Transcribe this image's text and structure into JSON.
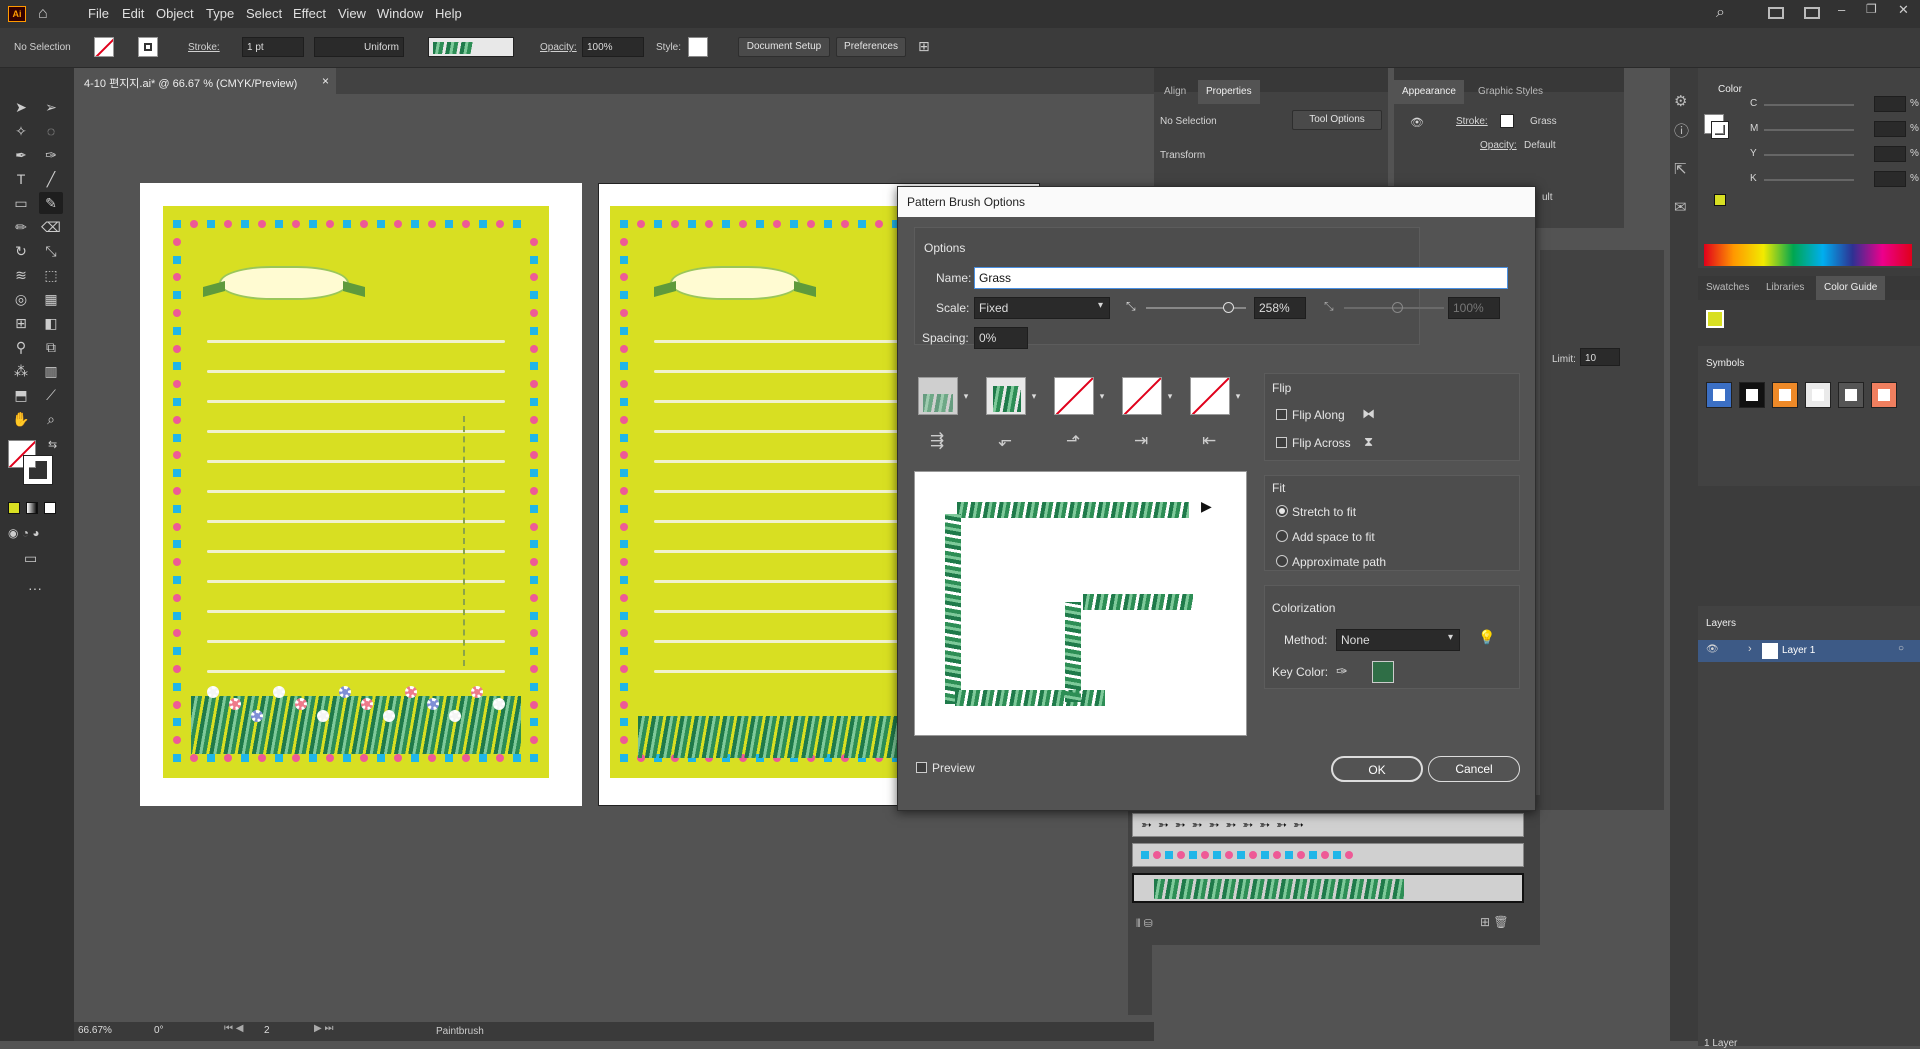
{
  "menubar": {
    "app_badge": "Ai",
    "items": [
      "File",
      "Edit",
      "Object",
      "Type",
      "Select",
      "Effect",
      "View",
      "Window",
      "Help"
    ]
  },
  "control_bar": {
    "selection": "No Selection",
    "stroke_label": "Stroke:",
    "stroke_weight": "1 pt",
    "profile": "Uniform",
    "opacity_label": "Opacity:",
    "opacity": "100%",
    "style_label": "Style:",
    "document_setup": "Document Setup",
    "preferences": "Preferences"
  },
  "document": {
    "tab_title": "4-10 편지지.ai* @ 66.67 % (CMYK/Preview)",
    "close": "×"
  },
  "status_bar": {
    "zoom": "66.67%",
    "rotation": "0°",
    "artboard": "2",
    "tool": "Paintbrush"
  },
  "properties_panel": {
    "tabs": [
      "Align",
      "Properties"
    ],
    "no_selection": "No Selection",
    "tool_options": "Tool Options",
    "transform": "Transform"
  },
  "appearance_panel": {
    "tabs": [
      "Appearance",
      "Graphic Styles"
    ],
    "stroke_label": "Stroke:",
    "stroke_value": "Grass",
    "opacity_label": "Opacity:",
    "opacity_value": "Default",
    "partial": "ult",
    "limit_label": "Limit:",
    "limit_value": "10"
  },
  "color_panel": {
    "title": "Color",
    "channels": [
      "C",
      "M",
      "Y",
      "K"
    ],
    "unit": "%"
  },
  "swatch_tabs": [
    "Swatches",
    "Libraries",
    "Color Guide"
  ],
  "symbols": {
    "title": "Symbols"
  },
  "layers": {
    "title": "Layers",
    "layer_name": "Layer 1",
    "count": "1 Layer"
  },
  "pattern_brush_dialog": {
    "title": "Pattern Brush Options",
    "options_label": "Options",
    "name_label": "Name:",
    "name_value": "Grass",
    "scale_label": "Scale:",
    "scale_mode": "Fixed",
    "scale_value": "258%",
    "scale_max": "100%",
    "spacing_label": "Spacing:",
    "spacing_value": "0%",
    "flip_label": "Flip",
    "flip_along": "Flip Along",
    "flip_across": "Flip Across",
    "fit_label": "Fit",
    "fit_options": [
      "Stretch to fit",
      "Add space to fit",
      "Approximate path"
    ],
    "fit_selected": "Stretch to fit",
    "colorization_label": "Colorization",
    "method_label": "Method:",
    "method_value": "None",
    "key_color_label": "Key Color:",
    "key_color": "#2f6e46",
    "preview_label": "Preview",
    "ok": "OK",
    "cancel": "Cancel"
  },
  "colors": {
    "letter_bg": "#d8df22",
    "dot_pink": "#ee5a96",
    "dot_blue": "#20b6e8",
    "grass_green": "#2d8e55"
  }
}
